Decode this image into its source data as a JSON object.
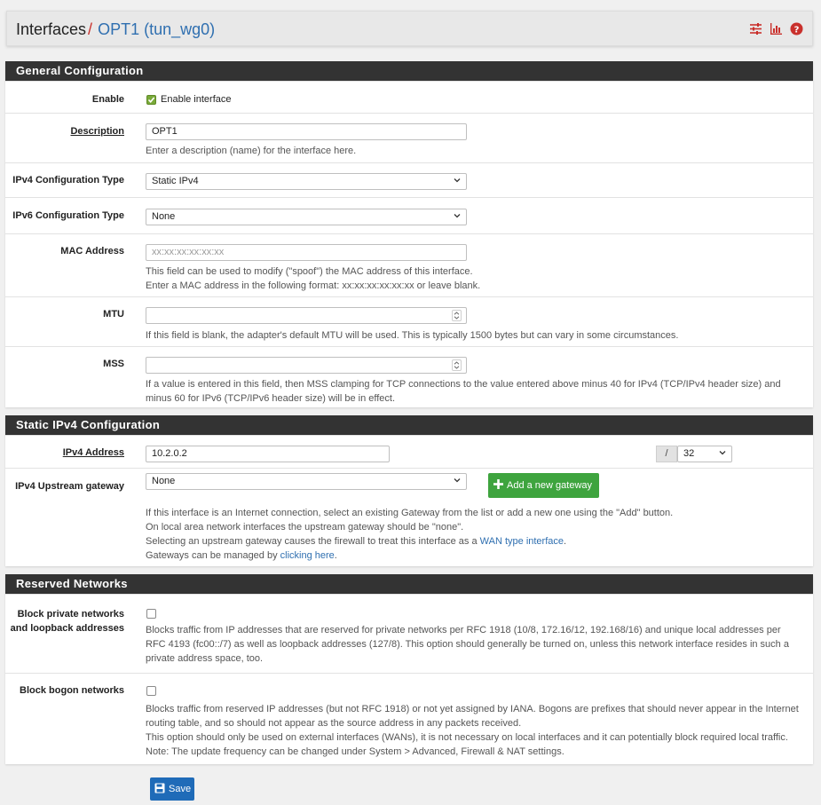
{
  "header": {
    "breadcrumb_root": "Interfaces",
    "breadcrumb_sep": "/",
    "breadcrumb_current": "OPT1 (tun_wg0)",
    "icons": [
      "sliders-icon",
      "bar-chart-icon",
      "help-icon"
    ]
  },
  "general": {
    "title": "General Configuration",
    "enable_label": "Enable",
    "enable_checkbox_label": "Enable interface",
    "enable_checked": true,
    "description_label": "Description",
    "description_value": "OPT1",
    "description_help": "Enter a description (name) for the interface here.",
    "ipv4_type_label": "IPv4 Configuration Type",
    "ipv4_type_value": "Static IPv4",
    "ipv6_type_label": "IPv6 Configuration Type",
    "ipv6_type_value": "None",
    "mac_label": "MAC Address",
    "mac_placeholder": "xx:xx:xx:xx:xx:xx",
    "mac_help_1": "This field can be used to modify (\"spoof\") the MAC address of this interface.",
    "mac_help_2": "Enter a MAC address in the following format: xx:xx:xx:xx:xx:xx or leave blank.",
    "mtu_label": "MTU",
    "mtu_value": "",
    "mtu_help": "If this field is blank, the adapter's default MTU will be used. This is typically 1500 bytes but can vary in some circumstances.",
    "mss_label": "MSS",
    "mss_value": "",
    "mss_help_1": "If a value is entered in this field, then MSS clamping for TCP connections to the value entered above minus 40 for IPv4 (TCP/IPv4 header size) and",
    "mss_help_2": "minus 60 for IPv6 (TCP/IPv6 header size) will be in effect."
  },
  "static_ipv4": {
    "title": "Static IPv4 Configuration",
    "address_label": "IPv4 Address",
    "address_value": "10.2.0.2",
    "cidr_sep": "/",
    "cidr_value": "32",
    "gateway_label": "IPv4 Upstream gateway",
    "gateway_value": "None",
    "add_gateway_label": "Add a new gateway",
    "help_1": "If this interface is an Internet connection, select an existing Gateway from the list or add a new one using the \"Add\" button.",
    "help_2": "On local area network interfaces the upstream gateway should be \"none\".",
    "help_3_text": "Selecting an upstream gateway causes the firewall to treat this interface as a ",
    "help_3_link": "WAN type interface",
    "help_3_end": ".",
    "help_4_text": "Gateways can be managed by ",
    "help_4_link": "clicking here",
    "help_4_end": "."
  },
  "reserved": {
    "title": "Reserved Networks",
    "private_label_1": "Block private networks",
    "private_label_2": "and loopback addresses",
    "private_checked": false,
    "private_help_1": "Blocks traffic from IP addresses that are reserved for private networks per RFC 1918 (10/8, 172.16/12, 192.168/16) and unique local addresses per",
    "private_help_2": "RFC 4193 (fc00::/7) as well as loopback addresses (127/8). This option should generally be turned on, unless this network interface resides in such a",
    "private_help_3": "private address space, too.",
    "bogon_label": "Block bogon networks",
    "bogon_checked": false,
    "bogon_help_1": "Blocks traffic from reserved IP addresses (but not RFC 1918) or not yet assigned by IANA. Bogons are prefixes that should never appear in the Internet",
    "bogon_help_2": "routing table, and so should not appear as the source address in any packets received.",
    "bogon_help_3": "This option should only be used on external interfaces (WANs), it is not necessary on local interfaces and it can potentially block required local traffic.",
    "bogon_help_4": "Note: The update frequency can be changed under System > Advanced, Firewall & NAT settings."
  },
  "save_label": "Save",
  "colors": {
    "accent_blue": "#2f6fb0",
    "accent_red": "#c9302c",
    "panel_header": "#333333",
    "button_green": "#3ea43e",
    "button_blue": "#1f6bb8"
  }
}
